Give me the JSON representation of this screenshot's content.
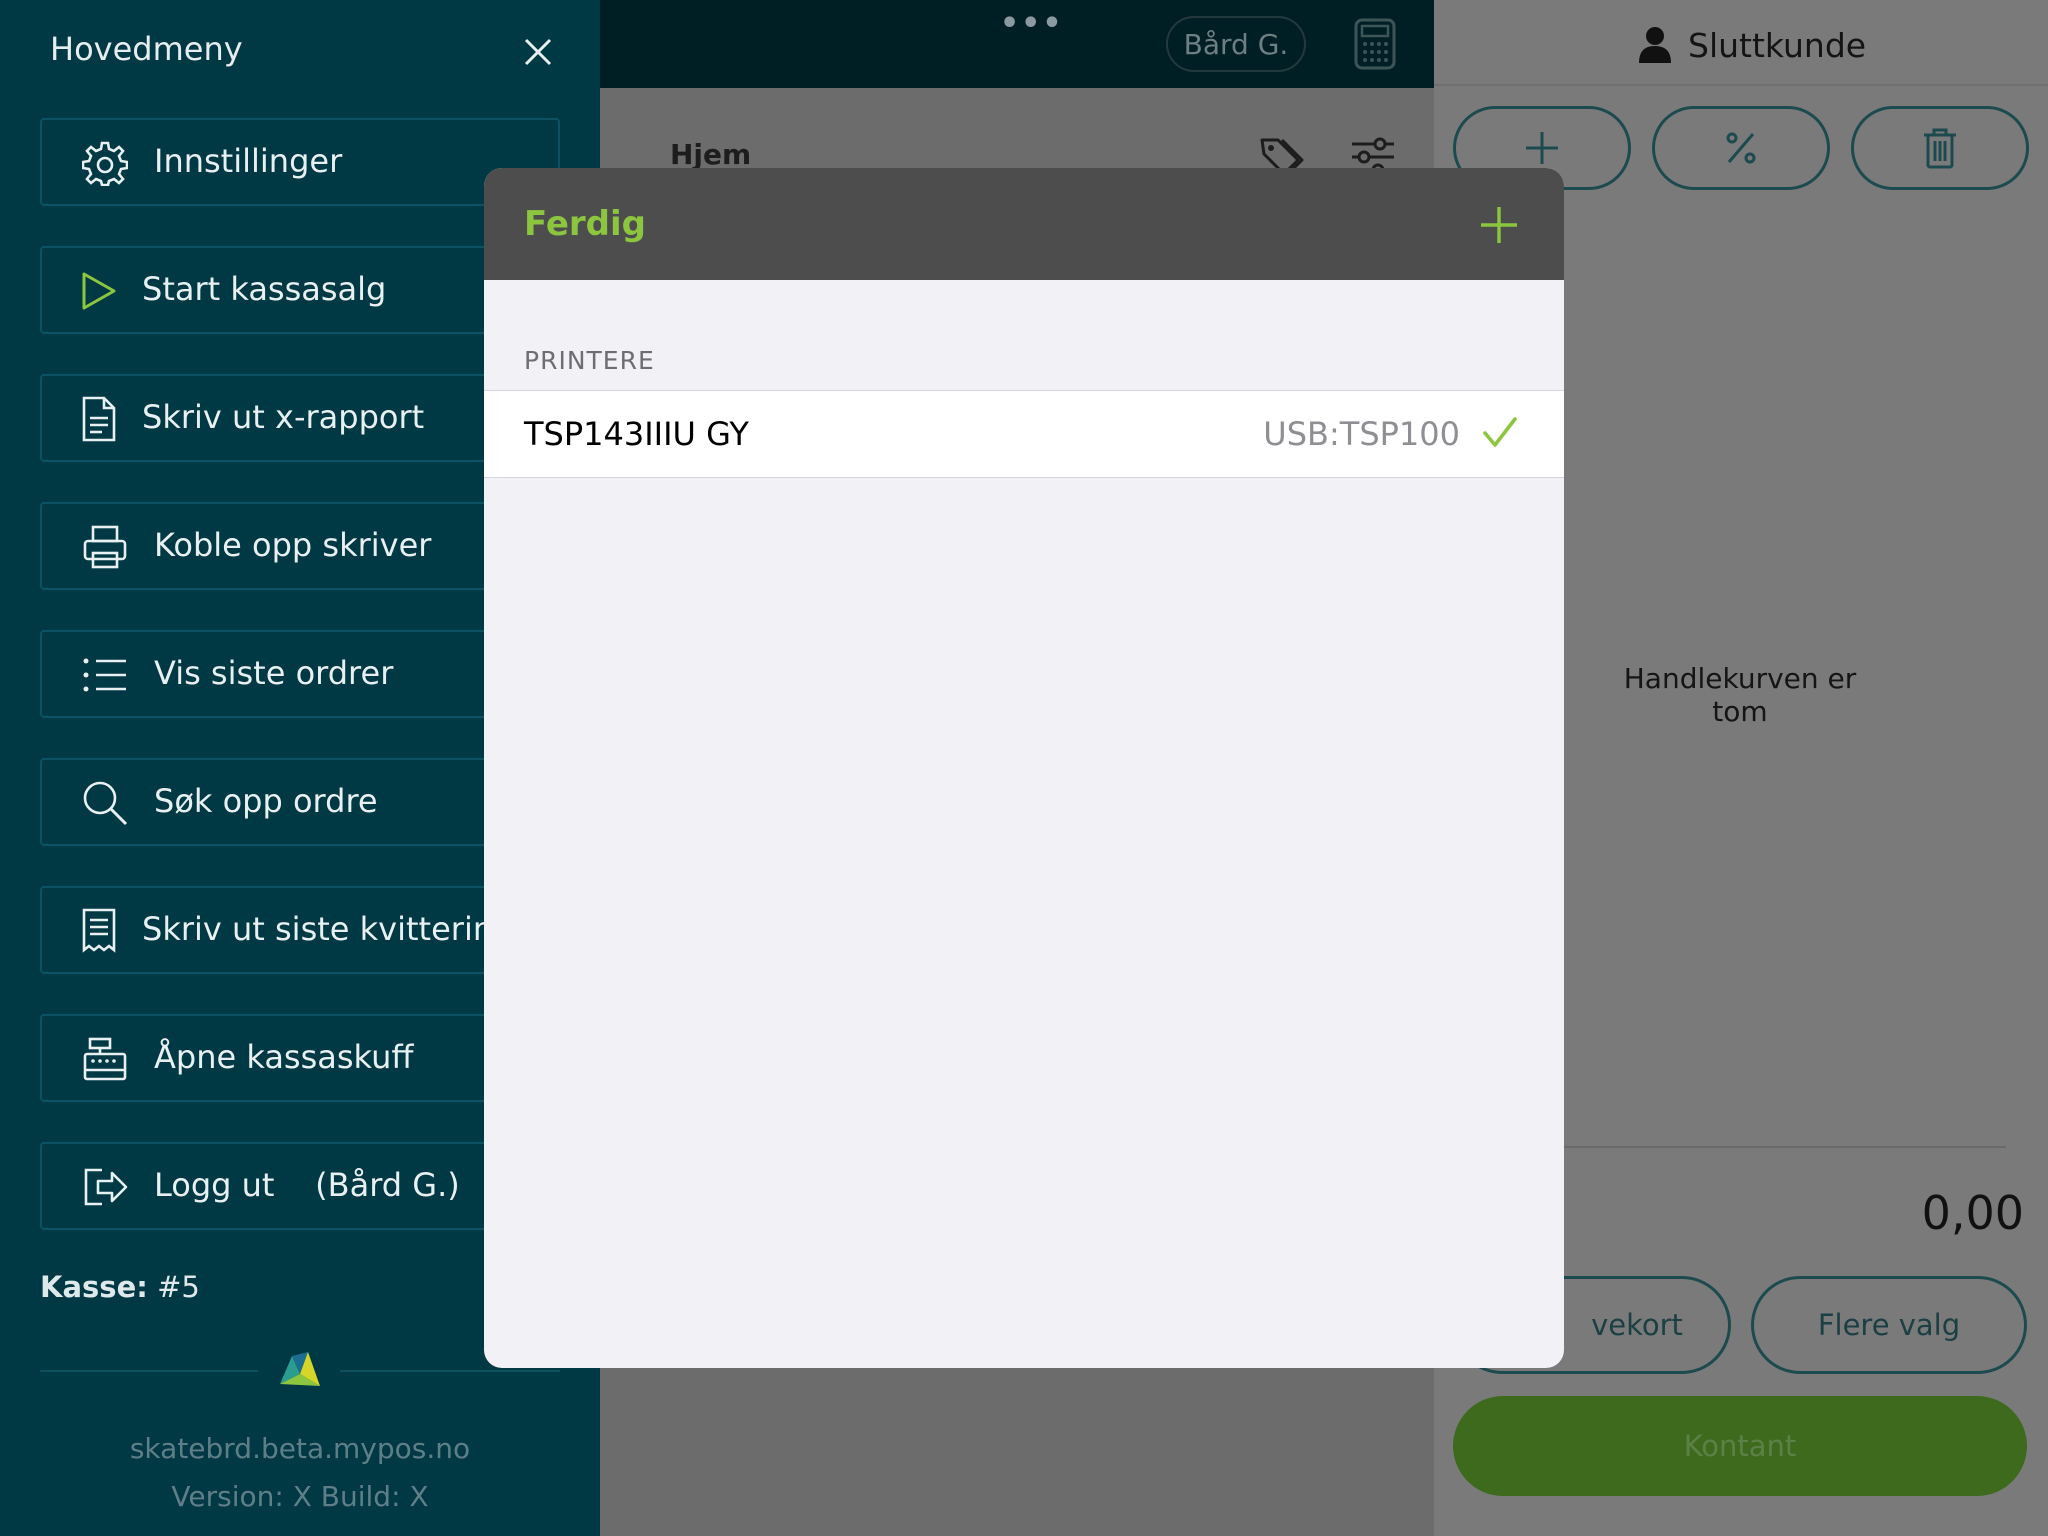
{
  "topbar": {
    "user": "Bård G."
  },
  "content": {
    "home_label": "Hjem"
  },
  "cart": {
    "customer": "Sluttkunde",
    "empty_text": "Handlekurven er tom",
    "total": "0,00",
    "giftcard_label": "vekort",
    "more_label": "Flere valg",
    "cash_label": "Kontant"
  },
  "side_menu": {
    "title": "Hovedmeny",
    "items": [
      {
        "label": "Innstillinger",
        "icon": "gear-icon"
      },
      {
        "label": "Start kassasalg",
        "icon": "play-icon"
      },
      {
        "label": "Skriv ut x-rapport",
        "icon": "document-icon"
      },
      {
        "label": "Koble opp skriver",
        "icon": "printer-icon"
      },
      {
        "label": "Vis siste ordrer",
        "icon": "list-icon"
      },
      {
        "label": "Søk opp ordre",
        "icon": "search-icon"
      },
      {
        "label": "Skriv ut siste kvittering",
        "icon": "receipt-icon"
      },
      {
        "label": "Åpne kassaskuff",
        "icon": "cash-register-icon"
      },
      {
        "label": "Logg ut    (Bård G.)",
        "icon": "logout-icon"
      }
    ],
    "kasse_label": "Kasse:",
    "kasse_value": "#5",
    "domain": "skatebrd.beta.mypos.no",
    "version": "Version: X Build: X"
  },
  "dialog": {
    "done_label": "Ferdig",
    "section_header": "PRINTERE",
    "printers": [
      {
        "name": "TSP143IIIU GY",
        "port": "USB:TSP100",
        "selected": true
      }
    ]
  },
  "colors": {
    "menu_bg": "#003844",
    "accent_green": "#8cc63f",
    "dialog_header": "#4d4d4d"
  }
}
